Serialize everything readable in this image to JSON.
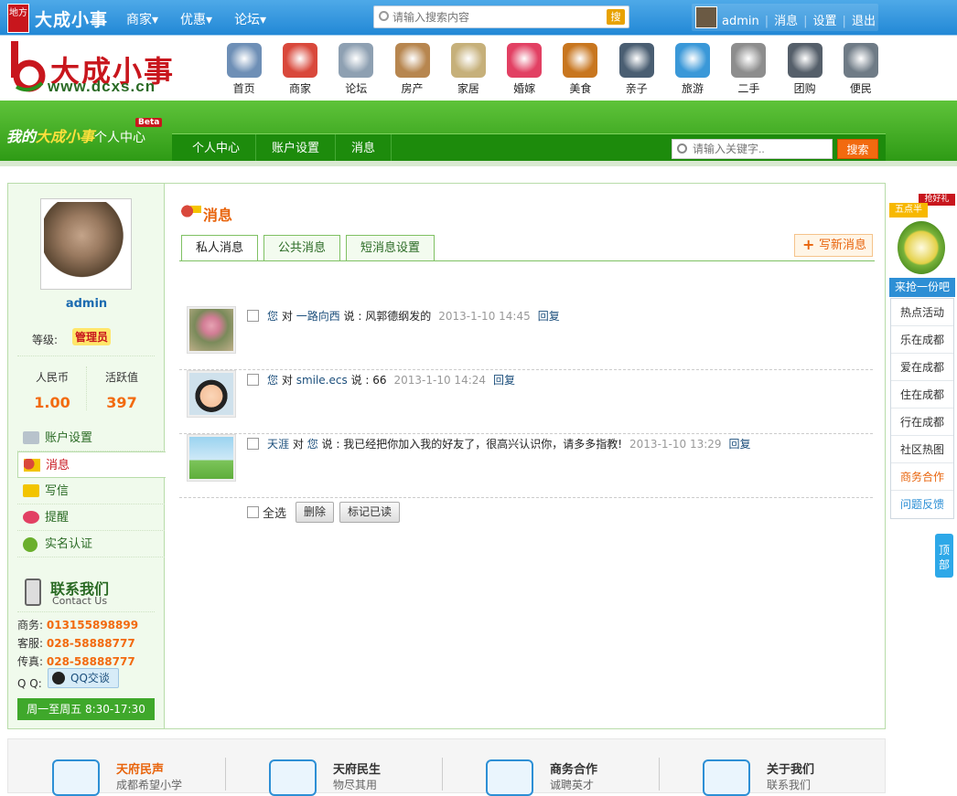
{
  "topbar": {
    "local_badge": "地方",
    "logo": "大成小事",
    "nav": [
      "商家▾",
      "优惠▾",
      "论坛▾"
    ],
    "search_placeholder": "请输入搜索内容",
    "search_btn": "搜",
    "user": "admin",
    "links": [
      "消息",
      "设置",
      "退出"
    ]
  },
  "header": {
    "logo_text": "大成小事",
    "logo_url": "www.dcxs.cn",
    "categories": [
      {
        "label": "首页",
        "icon": "windmill-icon",
        "color": "#6e8fb6"
      },
      {
        "label": "商家",
        "icon": "calendar-icon",
        "color": "#d9483b"
      },
      {
        "label": "论坛",
        "icon": "joystick-icon",
        "color": "#8ea0b2"
      },
      {
        "label": "房产",
        "icon": "house-icon",
        "color": "#b7864f"
      },
      {
        "label": "家居",
        "icon": "brush-icon",
        "color": "#c6b07a"
      },
      {
        "label": "婚嫁",
        "icon": "heart-icon",
        "color": "#e24063"
      },
      {
        "label": "美食",
        "icon": "burger-icon",
        "color": "#c8761f"
      },
      {
        "label": "亲子",
        "icon": "penguin-icon",
        "color": "#4a5e72"
      },
      {
        "label": "旅游",
        "icon": "globe-icon",
        "color": "#3a98d8"
      },
      {
        "label": "二手",
        "icon": "recycle-icon",
        "color": "#8d8d8d"
      },
      {
        "label": "团购",
        "icon": "camera-icon",
        "color": "#555f6a"
      },
      {
        "label": "便民",
        "icon": "tools-icon",
        "color": "#6f7b86"
      }
    ]
  },
  "banner": {
    "my": "我的",
    "org": "大成小事",
    "center": "个人中心",
    "beta": "Beta",
    "subnav": [
      "个人中心",
      "账户设置",
      "消息"
    ],
    "search_placeholder": "请输入关键字..",
    "search_btn": "搜索"
  },
  "sidebar": {
    "username": "admin",
    "level_label": "等级:",
    "level_value": "管理员",
    "stats": [
      {
        "label": "人民币",
        "value": "1.00"
      },
      {
        "label": "活跃值",
        "value": "397"
      }
    ],
    "menu": [
      "账户设置",
      "消息",
      "写信",
      "提醒",
      "实名认证"
    ],
    "contact_title": "联系我们",
    "contact_sub": "Contact Us",
    "contacts": [
      {
        "label": "商务:",
        "value": "013155898899"
      },
      {
        "label": "客服:",
        "value": "028-58888777"
      },
      {
        "label": "传真:",
        "value": "028-58888777"
      }
    ],
    "qq_label": "Q Q:",
    "qq_btn": "QQ交谈",
    "hours": "周一至周五 8:30-17:30"
  },
  "main": {
    "title": "消息",
    "tabs": [
      "私人消息",
      "公共消息",
      "短消息设置"
    ],
    "write_btn": "写新消息",
    "messages": [
      {
        "from": "您",
        "to": "一路向西",
        "text": "说 : 风郭德纲发的",
        "time": "2013-1-10 14:45",
        "reply": "回复",
        "thumb": "flower"
      },
      {
        "from": "您",
        "to": "smile.ecs",
        "text": "说 : 66",
        "time": "2013-1-10 14:24",
        "reply": "回复",
        "thumb": "boy"
      },
      {
        "from": "天涯",
        "to": "您",
        "text": "说 : 我已经把你加入我的好友了，很高兴认识你，请多多指教!",
        "time": "2013-1-10 13:29",
        "reply": "回复",
        "thumb": "cartoon"
      }
    ],
    "select_all": "全选",
    "delete_btn": "删除",
    "mark_read_btn": "标记已读",
    "connector": "对"
  },
  "right_float": {
    "grab": "抢好礼",
    "tag": "五点半",
    "pick": "来抢一份吧",
    "items": [
      "热点活动",
      "乐在成都",
      "爱在成都",
      "住在成都",
      "行在成都",
      "社区热图",
      "商务合作",
      "问题反馈"
    ],
    "top": "顶部"
  },
  "footer": [
    {
      "title": "天府民声",
      "sub": "成都希望小学"
    },
    {
      "title": "天府民生",
      "sub": "物尽其用"
    },
    {
      "title": "商务合作",
      "sub": "诚聘英才"
    },
    {
      "title": "关于我们",
      "sub": "联系我们"
    }
  ]
}
